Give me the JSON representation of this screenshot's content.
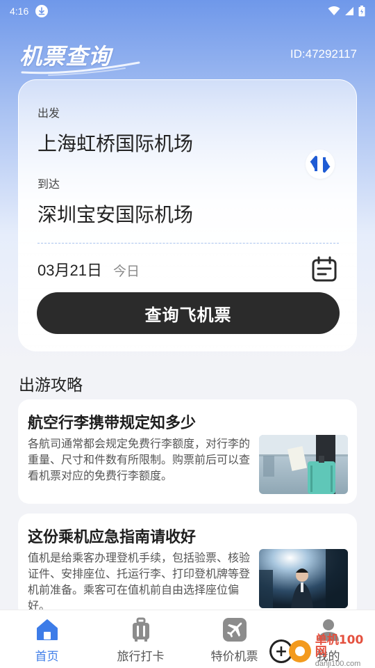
{
  "status_bar": {
    "time": "4:16",
    "icons": [
      "download-icon",
      "wifi-icon",
      "signal-icon",
      "battery-icon"
    ]
  },
  "header": {
    "title": "机票查询",
    "user_id": "ID:47292117"
  },
  "search": {
    "from_label": "出发",
    "from_value": "上海虹桥国际机场",
    "to_label": "到达",
    "to_value": "深圳宝安国际机场",
    "date": "03月21日",
    "date_hint": "今日",
    "button_label": "查询飞机票"
  },
  "guides": {
    "section_title": "出游攻略",
    "items": [
      {
        "title": "航空行李携带规定知多少",
        "text": "各航司通常都会规定免费行李额度，对行李的重量、尺寸和件数有所限制。购票前后可以查看机票对应的免费行李额度。"
      },
      {
        "title": "这份乘机应急指南请收好",
        "text": "值机是给乘客办理登机手续，包括验票、核验证件、安排座位、托运行李、打印登机牌等登机前准备。乘客可在值机前自由选择座位偏好。"
      }
    ]
  },
  "nav": {
    "items": [
      {
        "label": "首页",
        "icon": "home-icon"
      },
      {
        "label": "旅行打卡",
        "icon": "suitcase-icon"
      },
      {
        "label": "特价机票",
        "icon": "plane-icon"
      },
      {
        "label": "我的",
        "icon": "user-icon"
      }
    ]
  },
  "watermark": {
    "main": "单机100网",
    "sub": "danji100.com"
  },
  "colors": {
    "accent": "#3d7ce8",
    "button": "#2b2b2b",
    "header_gradient_top": "#6f98ea"
  }
}
